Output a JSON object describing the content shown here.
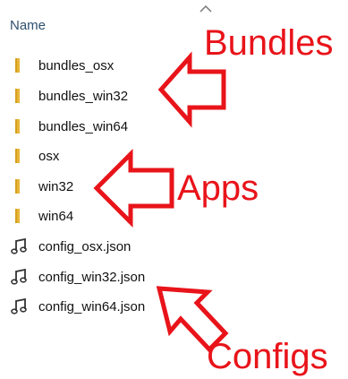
{
  "header": {
    "name_label": "Name",
    "sort_icon": "chevron-up-icon"
  },
  "files": [
    {
      "name": "bundles_osx",
      "type": "folder",
      "icon": "folder-icon"
    },
    {
      "name": "bundles_win32",
      "type": "folder",
      "icon": "folder-icon"
    },
    {
      "name": "bundles_win64",
      "type": "folder",
      "icon": "folder-icon"
    },
    {
      "name": "osx",
      "type": "folder",
      "icon": "folder-icon"
    },
    {
      "name": "win32",
      "type": "folder",
      "icon": "folder-icon"
    },
    {
      "name": "win64",
      "type": "folder",
      "icon": "folder-icon"
    },
    {
      "name": "config_osx.json",
      "type": "json",
      "icon": "json-file-icon"
    },
    {
      "name": "config_win32.json",
      "type": "json",
      "icon": "json-file-icon"
    },
    {
      "name": "config_win64.json",
      "type": "json",
      "icon": "json-file-icon"
    }
  ],
  "annotations": {
    "bundles": "Bundles",
    "apps": "Apps",
    "configs": "Configs",
    "color": "#e8141a"
  },
  "colors": {
    "folder": "#e8b537",
    "folder_dark": "#d4a020",
    "text": "#111111",
    "header_text": "#2f4f6f"
  }
}
